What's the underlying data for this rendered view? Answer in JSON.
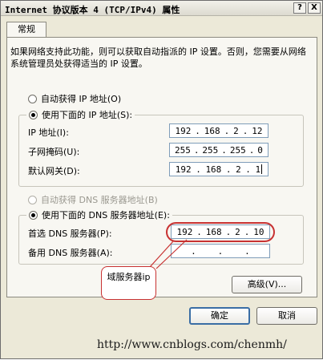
{
  "window": {
    "title": "Internet 协议版本 4 (TCP/IPv4) 属性",
    "help_glyph": "?",
    "close_glyph": "X"
  },
  "tabs": [
    {
      "label": "常规"
    }
  ],
  "description": "如果网络支持此功能，则可以获取自动指派的 IP 设置。否则，您需要从网络系统管理员处获得适当的 IP 设置。",
  "ip_mode": {
    "auto_label": "自动获得 IP 地址(O)",
    "manual_label": "使用下面的 IP 地址(S):",
    "selected": "manual"
  },
  "ip_fields": [
    {
      "label": "IP 地址(I):",
      "octets": [
        "192",
        "168",
        "2",
        "12"
      ]
    },
    {
      "label": "子网掩码(U):",
      "octets": [
        "255",
        "255",
        "255",
        "0"
      ]
    },
    {
      "label": "默认网关(D):",
      "octets": [
        "192",
        "168",
        "2",
        "1"
      ]
    }
  ],
  "dns_mode": {
    "auto_label": "自动获得 DNS 服务器地址(B)",
    "manual_label": "使用下面的 DNS 服务器地址(E):",
    "selected": "manual",
    "auto_disabled": true
  },
  "dns_fields": [
    {
      "label": "首选 DNS 服务器(P):",
      "octets": [
        "192",
        "168",
        "2",
        "10"
      ]
    },
    {
      "label": "备用 DNS 服务器(A):",
      "octets": [
        "",
        "",
        "",
        ""
      ]
    }
  ],
  "buttons": {
    "advanced": "高级(V)...",
    "ok": "确定",
    "cancel": "取消"
  },
  "annotation": {
    "callout_text": "域服务器ip",
    "highlight_color": "#c83232"
  },
  "watermark": "http://www.cnblogs.com/chenmh/"
}
